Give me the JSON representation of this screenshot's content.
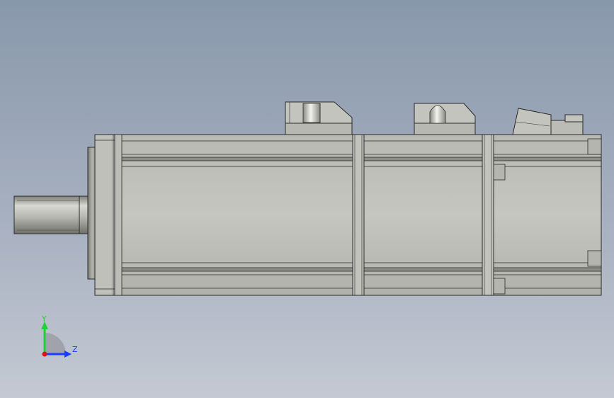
{
  "viewport": {
    "background_top": "#8898ab",
    "background_bottom": "#c4c9d3"
  },
  "model": {
    "description_icon": "servo-motor-side-view",
    "body_color": "#c2c2bc",
    "edge_color": "#2a2a2a",
    "shadow_color": "#8e8e88"
  },
  "triad": {
    "y_label": "Y",
    "z_label": "Z",
    "y_color": "#1fd13a",
    "z_color": "#1a3cff",
    "x_color": "#e01010"
  }
}
